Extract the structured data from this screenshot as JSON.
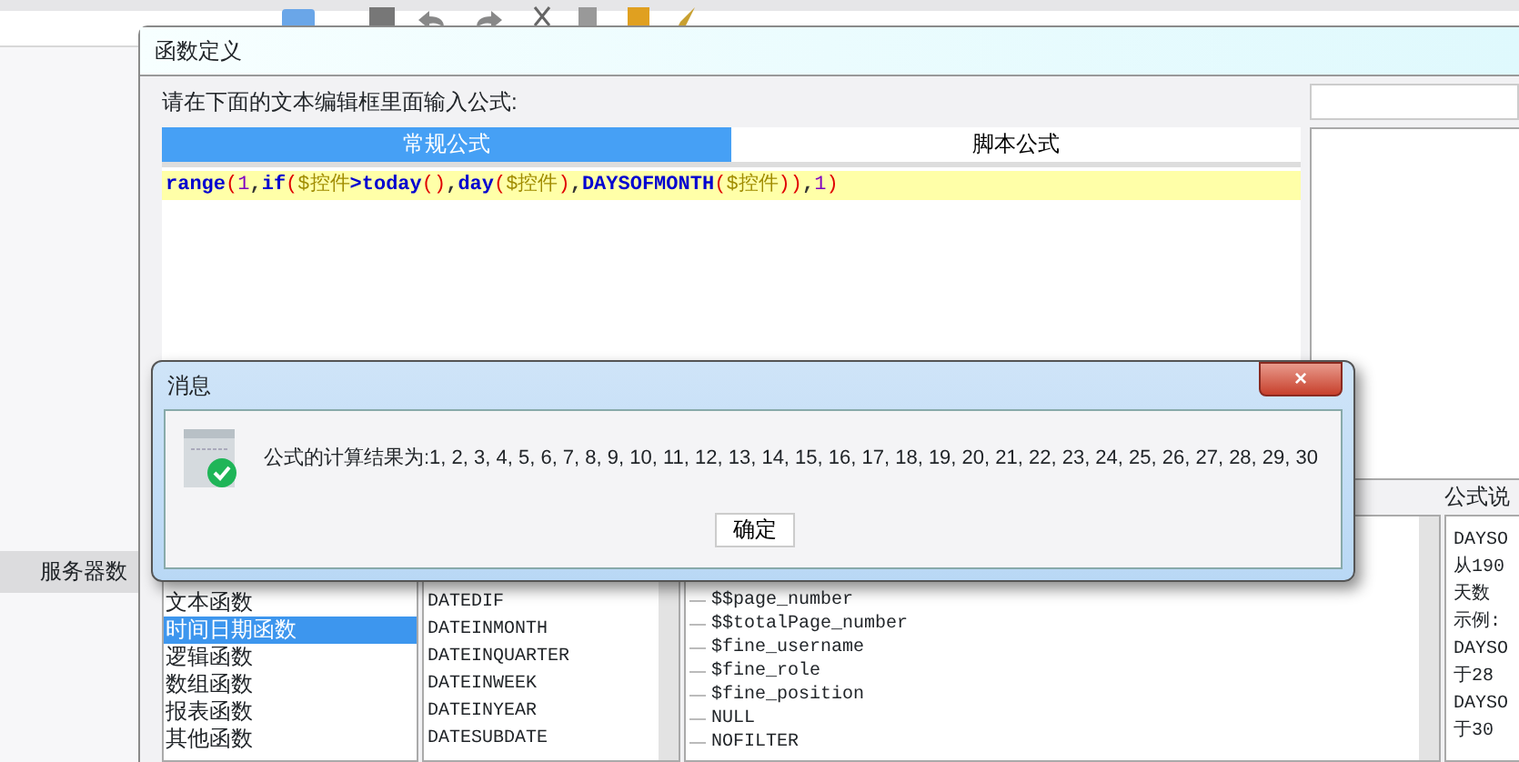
{
  "app": {
    "side_item": "服务器数"
  },
  "dialog": {
    "title": "函数定义",
    "prompt": "请在下面的文本编辑框里面输入公式:",
    "tabs": [
      {
        "label": "常规公式",
        "selected": true
      },
      {
        "label": "脚本公式",
        "selected": false
      }
    ],
    "formula": [
      {
        "kind": "fn",
        "text": "range"
      },
      {
        "kind": "paren",
        "text": "("
      },
      {
        "kind": "num",
        "text": "1"
      },
      {
        "kind": "sep",
        "text": ","
      },
      {
        "kind": "fn",
        "text": "if"
      },
      {
        "kind": "paren",
        "text": "("
      },
      {
        "kind": "var",
        "text": "$控件"
      },
      {
        "kind": "op",
        "text": ">"
      },
      {
        "kind": "fn",
        "text": "today"
      },
      {
        "kind": "paren",
        "text": "()"
      },
      {
        "kind": "sep",
        "text": ","
      },
      {
        "kind": "fn",
        "text": "day"
      },
      {
        "kind": "paren",
        "text": "("
      },
      {
        "kind": "var",
        "text": "$控件"
      },
      {
        "kind": "paren",
        "text": ")"
      },
      {
        "kind": "sep",
        "text": ","
      },
      {
        "kind": "fn",
        "text": "DAYSOFMONTH"
      },
      {
        "kind": "paren",
        "text": "("
      },
      {
        "kind": "var",
        "text": "$控件"
      },
      {
        "kind": "paren",
        "text": "))"
      },
      {
        "kind": "sep",
        "text": ","
      },
      {
        "kind": "num",
        "text": "1"
      },
      {
        "kind": "paren",
        "text": ")"
      }
    ],
    "categories": [
      {
        "label": "文本函数",
        "selected": false
      },
      {
        "label": "时间日期函数",
        "selected": true
      },
      {
        "label": "逻辑函数",
        "selected": false
      },
      {
        "label": "数组函数",
        "selected": false
      },
      {
        "label": "报表函数",
        "selected": false
      },
      {
        "label": "其他函数",
        "selected": false
      }
    ],
    "functions": [
      "DATEDIF",
      "DATEINMONTH",
      "DATEINQUARTER",
      "DATEINWEEK",
      "DATEINYEAR",
      "DATESUBDATE"
    ],
    "variables": [
      "$$page_number",
      "$$totalPage_number",
      "$fine_username",
      "$fine_role",
      "$fine_position",
      "NULL",
      "NOFILTER"
    ],
    "help_title": "公式说",
    "help_lines": [
      "DAYSO",
      "从190",
      "天数",
      "示例:",
      "DAYSO",
      "于28",
      "DAYSO",
      "于30"
    ]
  },
  "message": {
    "title": "消息",
    "close": "×",
    "text": "公式的计算结果为:1, 2, 3, 4, 5, 6, 7, 8, 9, 10, 11, 12, 13, 14, 15, 16, 17, 18, 19, 20, 21, 22, 23, 24, 25, 26, 27, 28, 29, 30",
    "button": "确定"
  }
}
